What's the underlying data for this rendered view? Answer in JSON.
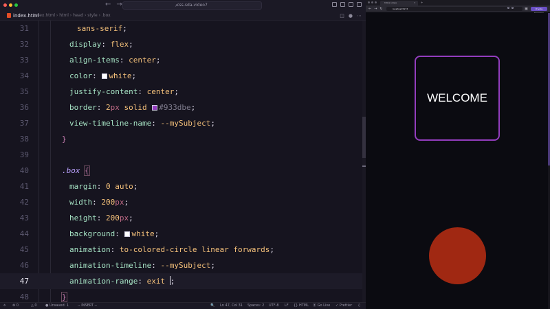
{
  "colors": {
    "editor_bg": "#16141f",
    "accent_border": "#933dbe",
    "circle": "#a02812",
    "swatch_white": "#ffffff",
    "swatch_purple": "#933dbe"
  },
  "editor": {
    "command_center": "css-sda-video7",
    "tab_label": "index.html",
    "breadcrumb": "index.html › html › head › style › .box",
    "code_lines": [
      {
        "num": "31",
        "indent": "  ",
        "parts": [
          {
            "text": "sans-serif",
            "cls": "t-val"
          },
          {
            "text": ";",
            "cls": "t-punc"
          }
        ]
      },
      {
        "num": "32",
        "indent": "",
        "parts": [
          {
            "text": "display",
            "cls": "t-prop"
          },
          {
            "text": ": ",
            "cls": "t-punc"
          },
          {
            "text": "flex",
            "cls": "t-val"
          },
          {
            "text": ";",
            "cls": "t-punc"
          }
        ]
      },
      {
        "num": "33",
        "indent": "",
        "parts": [
          {
            "text": "align-items",
            "cls": "t-prop"
          },
          {
            "text": ": ",
            "cls": "t-punc"
          },
          {
            "text": "center",
            "cls": "t-val"
          },
          {
            "text": ";",
            "cls": "t-punc"
          }
        ]
      },
      {
        "num": "34",
        "indent": "",
        "parts": [
          {
            "text": "color",
            "cls": "t-prop"
          },
          {
            "text": ": ",
            "cls": "t-punc"
          },
          {
            "swatch": "#ffffff"
          },
          {
            "text": "white",
            "cls": "t-val"
          },
          {
            "text": ";",
            "cls": "t-punc"
          }
        ]
      },
      {
        "num": "35",
        "indent": "",
        "parts": [
          {
            "text": "justify-content",
            "cls": "t-prop"
          },
          {
            "text": ": ",
            "cls": "t-punc"
          },
          {
            "text": "center",
            "cls": "t-val"
          },
          {
            "text": ";",
            "cls": "t-punc"
          }
        ]
      },
      {
        "num": "36",
        "indent": "",
        "parts": [
          {
            "text": "border",
            "cls": "t-prop"
          },
          {
            "text": ": ",
            "cls": "t-punc"
          },
          {
            "text": "2",
            "cls": "t-num"
          },
          {
            "text": "px",
            "cls": "t-unit"
          },
          {
            "text": " solid ",
            "cls": "t-val"
          },
          {
            "swatch": "#933dbe"
          },
          {
            "text": "#933dbe",
            "cls": "t-hex"
          },
          {
            "text": ";",
            "cls": "t-punc"
          }
        ]
      },
      {
        "num": "37",
        "indent": "",
        "parts": [
          {
            "text": "view-timeline-name",
            "cls": "t-prop"
          },
          {
            "text": ": ",
            "cls": "t-punc"
          },
          {
            "text": "--mySubject",
            "cls": "t-val"
          },
          {
            "text": ";",
            "cls": "t-punc"
          }
        ]
      },
      {
        "num": "38",
        "indent": "back",
        "parts": [
          {
            "text": "}",
            "cls": "t-brace"
          }
        ]
      },
      {
        "num": "39",
        "indent": "",
        "parts": []
      },
      {
        "num": "40",
        "indent": "back",
        "parts": [
          {
            "text": ".box",
            "cls": "t-sel"
          },
          {
            "text": " ",
            "cls": "t-punc"
          },
          {
            "text": "{",
            "cls": "t-brace-box"
          }
        ]
      },
      {
        "num": "41",
        "indent": "",
        "parts": [
          {
            "text": "margin",
            "cls": "t-prop"
          },
          {
            "text": ": ",
            "cls": "t-punc"
          },
          {
            "text": "0",
            "cls": "t-num"
          },
          {
            "text": " auto",
            "cls": "t-val"
          },
          {
            "text": ";",
            "cls": "t-punc"
          }
        ]
      },
      {
        "num": "42",
        "indent": "",
        "parts": [
          {
            "text": "width",
            "cls": "t-prop"
          },
          {
            "text": ": ",
            "cls": "t-punc"
          },
          {
            "text": "200",
            "cls": "t-num"
          },
          {
            "text": "px",
            "cls": "t-unit"
          },
          {
            "text": ";",
            "cls": "t-punc"
          }
        ]
      },
      {
        "num": "43",
        "indent": "",
        "parts": [
          {
            "text": "height",
            "cls": "t-prop"
          },
          {
            "text": ": ",
            "cls": "t-punc"
          },
          {
            "text": "200",
            "cls": "t-num"
          },
          {
            "text": "px",
            "cls": "t-unit"
          },
          {
            "text": ";",
            "cls": "t-punc"
          }
        ]
      },
      {
        "num": "44",
        "indent": "",
        "parts": [
          {
            "text": "background",
            "cls": "t-prop"
          },
          {
            "text": ": ",
            "cls": "t-punc"
          },
          {
            "swatch": "#ffffff"
          },
          {
            "text": "white",
            "cls": "t-val"
          },
          {
            "text": ";",
            "cls": "t-punc"
          }
        ]
      },
      {
        "num": "45",
        "indent": "",
        "parts": [
          {
            "text": "animation",
            "cls": "t-prop"
          },
          {
            "text": ": ",
            "cls": "t-punc"
          },
          {
            "text": "to-colored-circle linear forwards",
            "cls": "t-val"
          },
          {
            "text": ";",
            "cls": "t-punc"
          }
        ]
      },
      {
        "num": "46",
        "indent": "",
        "parts": [
          {
            "text": "animation-timeline",
            "cls": "t-prop"
          },
          {
            "text": ": ",
            "cls": "t-punc"
          },
          {
            "text": "--mySubject",
            "cls": "t-val"
          },
          {
            "text": ";",
            "cls": "t-punc"
          }
        ]
      },
      {
        "num": "47",
        "indent": "",
        "current": true,
        "parts": [
          {
            "text": "animation-range",
            "cls": "t-prop"
          },
          {
            "text": ": ",
            "cls": "t-punc"
          },
          {
            "text": "exit ",
            "cls": "t-val"
          },
          {
            "cursor": true
          },
          {
            "text": ";",
            "cls": "t-punc"
          }
        ]
      },
      {
        "num": "48",
        "indent": "back",
        "parts": [
          {
            "text": "}",
            "cls": "t-brace-box"
          }
        ]
      }
    ]
  },
  "statusbar": {
    "errors": "⊗ 0",
    "warnings": "△ 0",
    "unsaved": "● Unsaved: 1",
    "mode": "-- INSERT --",
    "zoom_icon": "🔍",
    "position": "Ln 47, Col 31",
    "spaces": "Spaces: 2",
    "encoding": "UTF-8",
    "eol": "LF",
    "language": "{} HTML",
    "golive": "⦿ Go Live",
    "prettier": "✓ Prettier"
  },
  "browser": {
    "tab_title": "Inline scope",
    "url": "localhost:5173",
    "pill": "Private browsing",
    "subject_text": "WELCOME"
  },
  "icons": [
    "html-file-icon",
    "search-icon",
    "bell-icon",
    "split-editor-icon",
    "more-icon",
    "reload-icon",
    "tab-close-icon",
    "new-tab-icon",
    "back-icon",
    "forward-icon"
  ]
}
